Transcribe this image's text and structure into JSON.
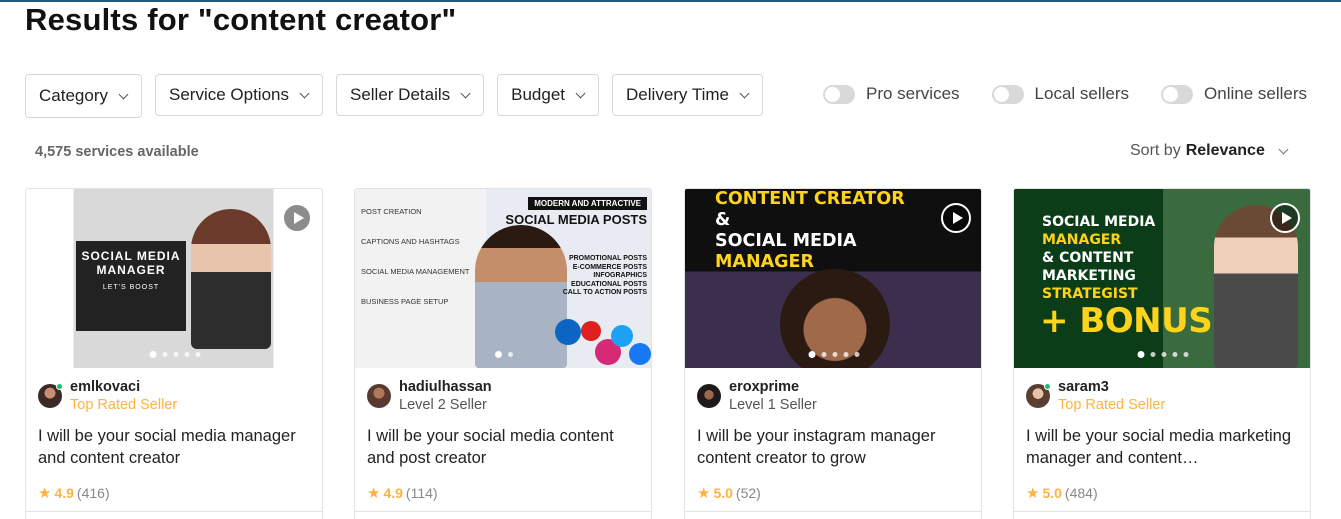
{
  "page": {
    "title": "Results for \"content creator\""
  },
  "filters": [
    {
      "label": "Category"
    },
    {
      "label": "Service Options"
    },
    {
      "label": "Seller Details"
    },
    {
      "label": "Budget"
    },
    {
      "label": "Delivery Time"
    }
  ],
  "toggles": [
    {
      "label": "Pro services",
      "on": false
    },
    {
      "label": "Local sellers",
      "on": false
    },
    {
      "label": "Online sellers",
      "on": false
    }
  ],
  "results": {
    "count_text": "4,575 services available",
    "sort_prefix": "Sort by",
    "sort_value": "Relevance"
  },
  "colors": {
    "top_rated": "#ffb33e",
    "star": "#ffb33e",
    "online": "#1dbf73"
  },
  "gigs": [
    {
      "seller": "emlkovaci",
      "level": "Top Rated Seller",
      "online": true,
      "title": "I will be your social media manager and content creator",
      "rating": "4.9",
      "reviews": "(416)",
      "has_video": true,
      "slides": 5,
      "thumb": {
        "panel_title": "SOCIAL MEDIA MANAGER",
        "panel_sub": "LET'S BOOST"
      }
    },
    {
      "seller": "hadiulhassan",
      "level": "Level 2 Seller",
      "online": false,
      "title": "I will be your social media content and post creator",
      "rating": "4.9",
      "reviews": "(114)",
      "has_video": false,
      "slides": 2,
      "thumb": {
        "left_items": [
          "Post Creation",
          "Captions and Hashtags",
          "Social Media Management",
          "Business Page Setup"
        ],
        "header": "MODERN AND ATTRACTIVE",
        "big": "SOCIAL MEDIA POSTS",
        "list": [
          "PROMOTIONAL POSTS",
          "E-COMMERCE POSTS",
          "INFOGRAPHICS",
          "EDUCATIONAL POSTS",
          "CALL TO ACTION POSTS"
        ]
      }
    },
    {
      "seller": "eroxprime",
      "level": "Level 1 Seller",
      "online": false,
      "title": "I will be your instagram manager content creator to grow",
      "rating": "5.0",
      "reviews": "(52)",
      "has_video": true,
      "slides": 5,
      "thumb": {
        "line1": "CONTENT CREATOR",
        "line2": "&",
        "line3": "SOCIAL MEDIA",
        "line4": "MANAGER"
      }
    },
    {
      "seller": "saram3",
      "level": "Top Rated Seller",
      "online": true,
      "title": "I will be your social media marketing manager and content…",
      "rating": "5.0",
      "reviews": "(484)",
      "has_video": true,
      "slides": 5,
      "thumb": {
        "line1": "SOCIAL MEDIA",
        "line2": "MANAGER",
        "line3": "& CONTENT",
        "line4": "MARKETING",
        "line5": "STRATEGIST",
        "bonus": "+ BONUS"
      }
    }
  ]
}
